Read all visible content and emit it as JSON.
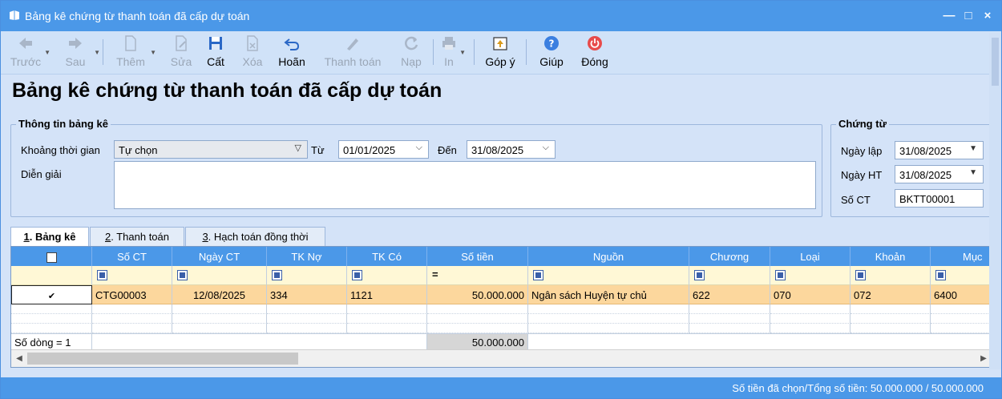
{
  "window": {
    "title": "Bảng kê chứng từ thanh toán đã cấp dự toán",
    "controls": [
      "—",
      "□",
      "×"
    ]
  },
  "toolbar": {
    "back": "Trước",
    "forward": "Sau",
    "add": "Thêm",
    "edit": "Sửa",
    "save": "Cất",
    "delete": "Xóa",
    "undo": "Hoãn",
    "pay": "Thanh toán",
    "load": "Nạp",
    "print": "In",
    "feedback": "Góp ý",
    "help": "Giúp",
    "close": "Đóng"
  },
  "page_title": "Bảng kê chứng từ thanh toán đã cấp dự toán",
  "info": {
    "legend": "Thông tin bảng kê",
    "period_label": "Khoảng thời gian",
    "period_value": "Tự chọn",
    "from_label": "Từ",
    "from_value": "01/01/2025",
    "to_label": "Đến",
    "to_value": "31/08/2025",
    "desc_label": "Diễn giải",
    "desc_value": ""
  },
  "voucher": {
    "legend": "Chứng từ",
    "created_label": "Ngày lập",
    "created_value": "31/08/2025",
    "posted_label": "Ngày HT",
    "posted_value": "31/08/2025",
    "no_label": "Số CT",
    "no_value": "BKTT00001"
  },
  "tabs": [
    {
      "num": "1",
      "label": ". Bảng kê"
    },
    {
      "num": "2",
      "label": ". Thanh toán"
    },
    {
      "num": "3",
      "label": ". Hạch toán đồng thời"
    }
  ],
  "grid": {
    "headers": [
      "Số CT",
      "Ngày CT",
      "TK Nợ",
      "TK Có",
      "Số tiền",
      "Nguồn",
      "Chương",
      "Loại",
      "Khoản",
      "Mục"
    ],
    "filter_eq": "=",
    "row": {
      "checked": "✔",
      "so_ct": "CTG00003",
      "ngay_ct": "12/08/2025",
      "tk_no": "334",
      "tk_co": "1121",
      "so_tien": "50.000.000",
      "nguon": "Ngân sách Huyện tự chủ",
      "chuong": "622",
      "loai": "070",
      "khoan": "072",
      "muc": "6400"
    },
    "row_count": "Số dòng = 1",
    "total": "50.000.000"
  },
  "status": {
    "text": "Số tiền đã chọn/Tổng số tiền: 50.000.000 / 50.000.000"
  }
}
